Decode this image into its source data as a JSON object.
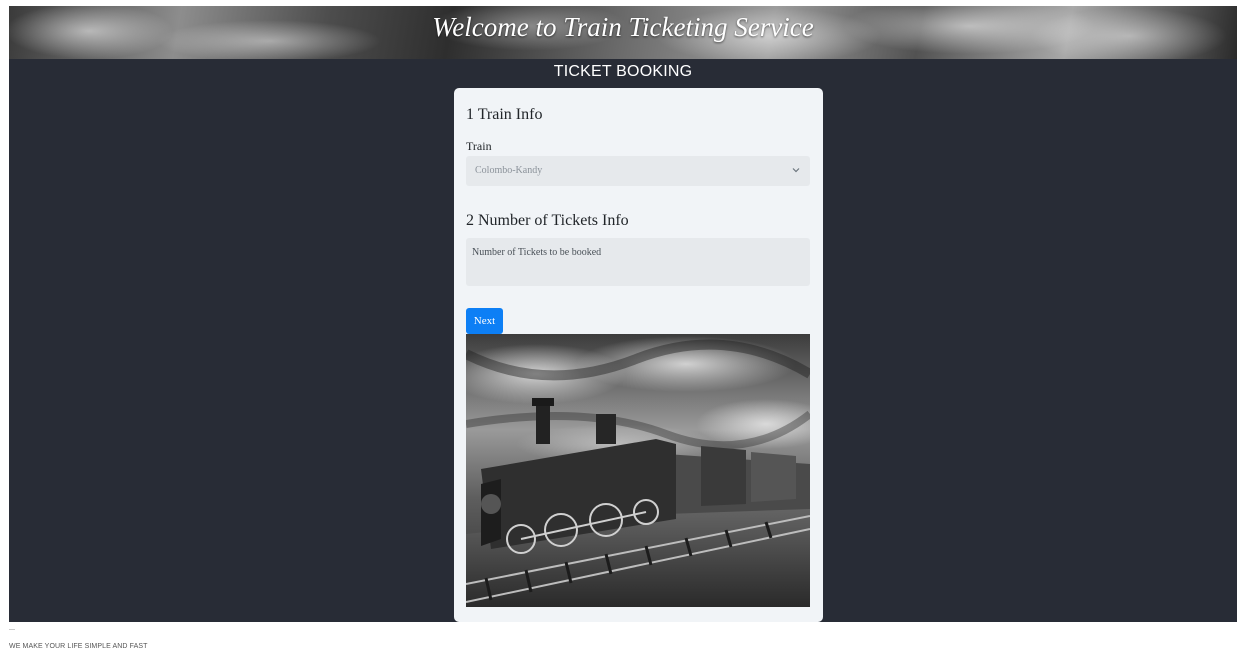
{
  "header": {
    "title": "Welcome to Train Ticketing Service"
  },
  "section": {
    "heading": "TICKET BOOKING"
  },
  "form": {
    "step1_title": "1 Train Info",
    "train_label": "Train",
    "train_selected": "Colombo-Kandy",
    "step2_title": "2 Number of Tickets Info",
    "tickets_placeholder": "Number of Tickets to be booked",
    "next_label": "Next"
  },
  "footer": {
    "dash": "---",
    "tagline": "WE MAKE YOUR LIFE SIMPLE AND FAST"
  },
  "colors": {
    "page_background": "#282c36",
    "card_background": "#f1f4f7",
    "button_primary": "#0d7ff5",
    "input_background": "#e6e9ec"
  },
  "icons": {
    "select_arrow": "chevron-down-icon"
  }
}
